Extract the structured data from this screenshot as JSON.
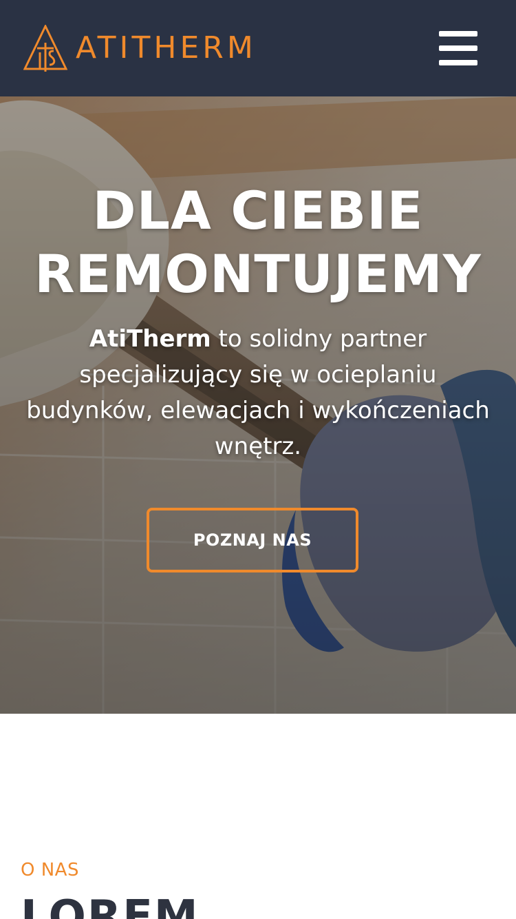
{
  "header": {
    "brand": "ATITHERM",
    "logo_icon": "atitherm-triangle-logo",
    "menu_icon": "hamburger-menu-icon"
  },
  "hero": {
    "title_line1": "DLA CIEBIE",
    "title_line2": "REMONTUJEMY",
    "text_brand": "AtiTherm",
    "text_rest": " to solidny partner specjalizujący się w ocieplaniu budynków, elewacjach i wykończeniach wnętrz.",
    "cta_label": "POZNAJ NAS"
  },
  "about": {
    "label": "O NAS",
    "heading": "LOREM"
  },
  "colors": {
    "header_bg": "#2a3244",
    "accent": "#f08a2c",
    "text_dark": "#2e3340",
    "white": "#ffffff"
  }
}
